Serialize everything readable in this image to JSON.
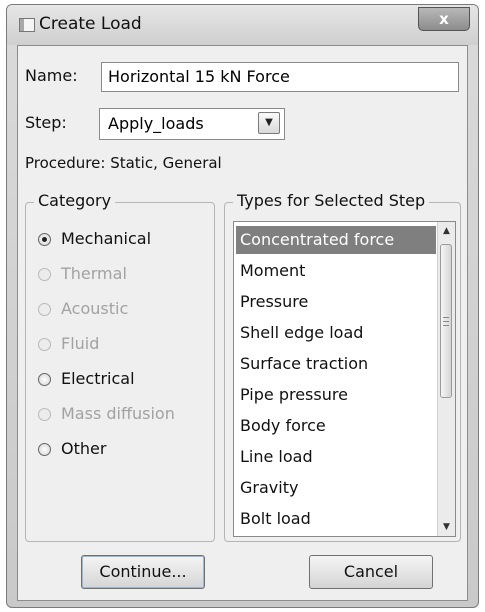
{
  "window": {
    "title": "Create Load",
    "close_glyph": "x"
  },
  "form": {
    "name_label": "Name:",
    "name_value": "Horizontal 15 kN Force",
    "step_label": "Step:",
    "step_value": "Apply_loads",
    "step_dropdown_glyph": "▼",
    "procedure_text": "Procedure:  Static, General"
  },
  "category": {
    "title": "Category",
    "options": [
      {
        "label": "Mechanical",
        "selected": true,
        "enabled": true
      },
      {
        "label": "Thermal",
        "selected": false,
        "enabled": false
      },
      {
        "label": "Acoustic",
        "selected": false,
        "enabled": false
      },
      {
        "label": "Fluid",
        "selected": false,
        "enabled": false
      },
      {
        "label": "Electrical",
        "selected": false,
        "enabled": true
      },
      {
        "label": "Mass diffusion",
        "selected": false,
        "enabled": false
      },
      {
        "label": "Other",
        "selected": false,
        "enabled": true
      }
    ]
  },
  "types": {
    "title": "Types for Selected Step",
    "items": [
      "Concentrated force",
      "Moment",
      "Pressure",
      "Shell edge load",
      "Surface traction",
      "Pipe pressure",
      "Body force",
      "Line load",
      "Gravity",
      "Bolt load"
    ],
    "selected_index": 0,
    "scroll_up_glyph": "▲",
    "scroll_down_glyph": "▼"
  },
  "buttons": {
    "continue_label": "Continue...",
    "cancel_label": "Cancel"
  }
}
